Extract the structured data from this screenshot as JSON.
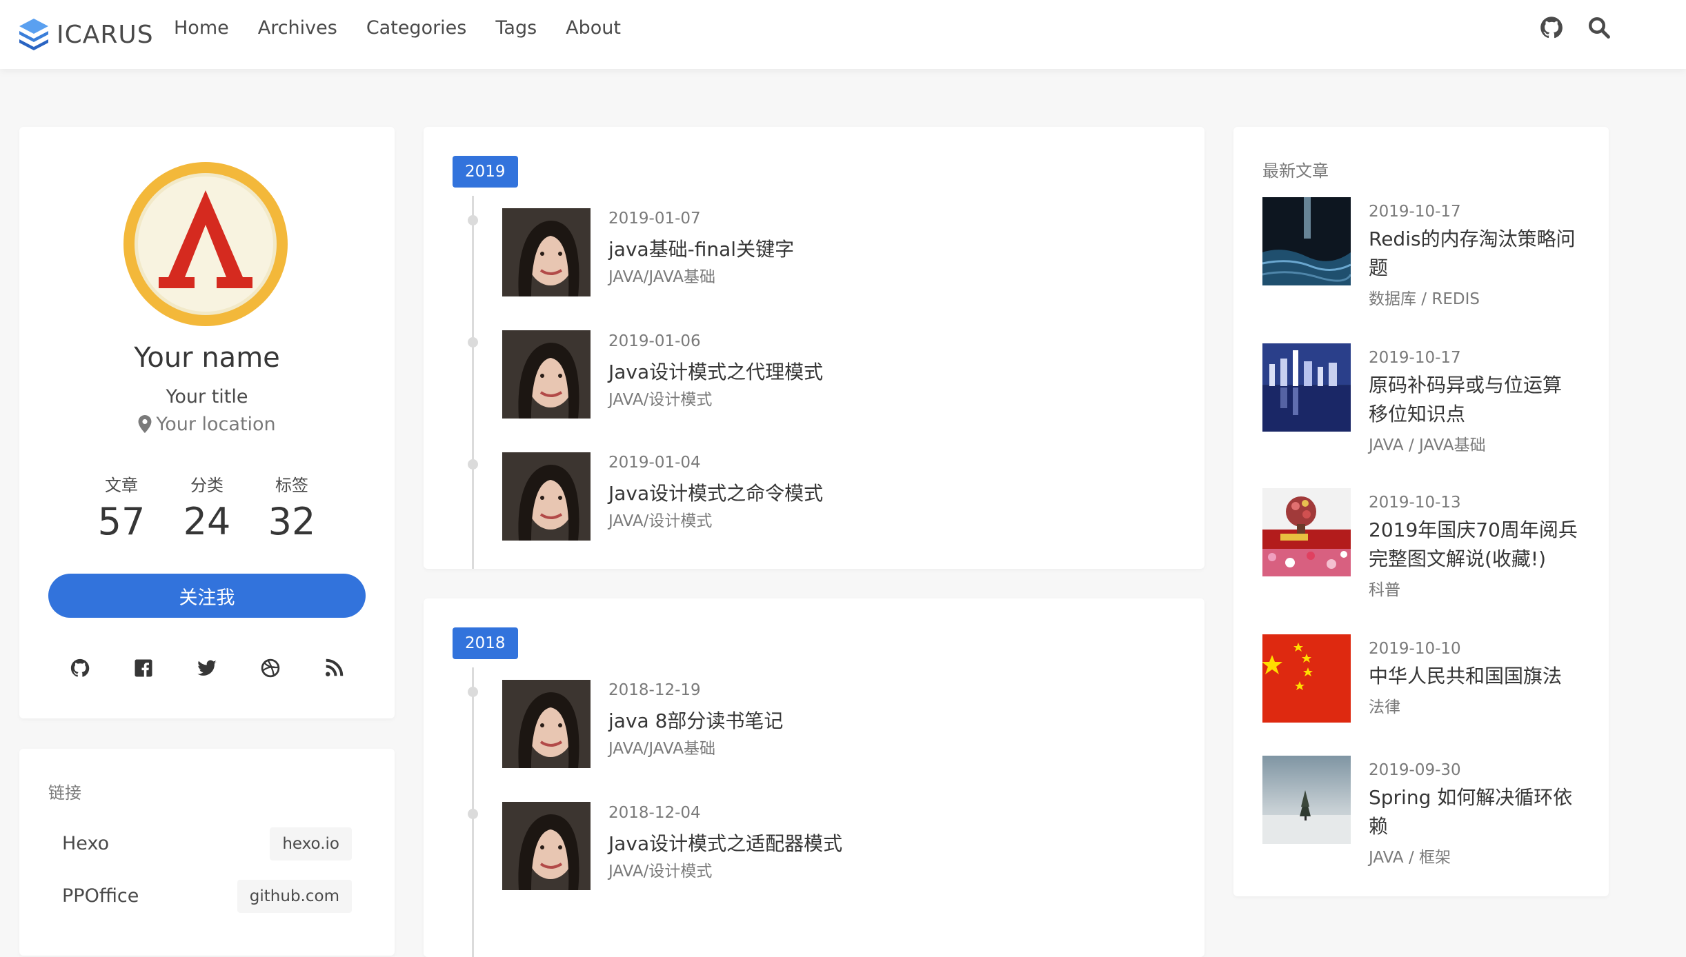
{
  "nav": {
    "brand": "ICARUS",
    "links": [
      "Home",
      "Archives",
      "Categories",
      "Tags",
      "About"
    ],
    "icons": [
      "github-icon",
      "search-icon"
    ]
  },
  "profile": {
    "name": "Your name",
    "title": "Your title",
    "location": "Your location",
    "stats": [
      {
        "label": "文章",
        "value": "57"
      },
      {
        "label": "分类",
        "value": "24"
      },
      {
        "label": "标签",
        "value": "32"
      }
    ],
    "follow": "关注我",
    "social": [
      "github-icon",
      "facebook-icon",
      "twitter-icon",
      "dribbble-icon",
      "rss-icon"
    ]
  },
  "links": {
    "heading": "链接",
    "items": [
      {
        "name": "Hexo",
        "tag": "hexo.io"
      },
      {
        "name": "PPOffice",
        "tag": "github.com"
      }
    ]
  },
  "timeline": [
    {
      "year": "2019",
      "posts": [
        {
          "date": "2019-01-07",
          "title": "java基础-final关键字",
          "category": "JAVA/JAVA基础"
        },
        {
          "date": "2019-01-06",
          "title": "Java设计模式之代理模式",
          "category": "JAVA/设计模式"
        },
        {
          "date": "2019-01-04",
          "title": "Java设计模式之命令模式",
          "category": "JAVA/设计模式"
        }
      ]
    },
    {
      "year": "2018",
      "posts": [
        {
          "date": "2018-12-19",
          "title": "java 8部分读书笔记",
          "category": "JAVA/JAVA基础"
        },
        {
          "date": "2018-12-04",
          "title": "Java设计模式之适配器模式",
          "category": "JAVA/设计模式"
        }
      ]
    }
  ],
  "recent": {
    "heading": "最新文章",
    "items": [
      {
        "date": "2019-10-17",
        "title_lines": [
          "Redis的内存淘汰策略问",
          "题"
        ],
        "category": "数据库 / REDIS"
      },
      {
        "date": "2019-10-17",
        "title_lines": [
          "原码补码异或与位运算",
          "移位知识点"
        ],
        "category": "JAVA / JAVA基础"
      },
      {
        "date": "2019-10-13",
        "title_lines": [
          "2019年国庆70周年阅兵",
          "完整图文解说(收藏!)"
        ],
        "category": "科普"
      },
      {
        "date": "2019-10-10",
        "title_lines": [
          "中华人民共和国国旗法"
        ],
        "category": "法律"
      },
      {
        "date": "2019-09-30",
        "title_lines": [
          "Spring 如何解决循环依",
          "赖"
        ],
        "category": "JAVA / 框架"
      }
    ]
  }
}
